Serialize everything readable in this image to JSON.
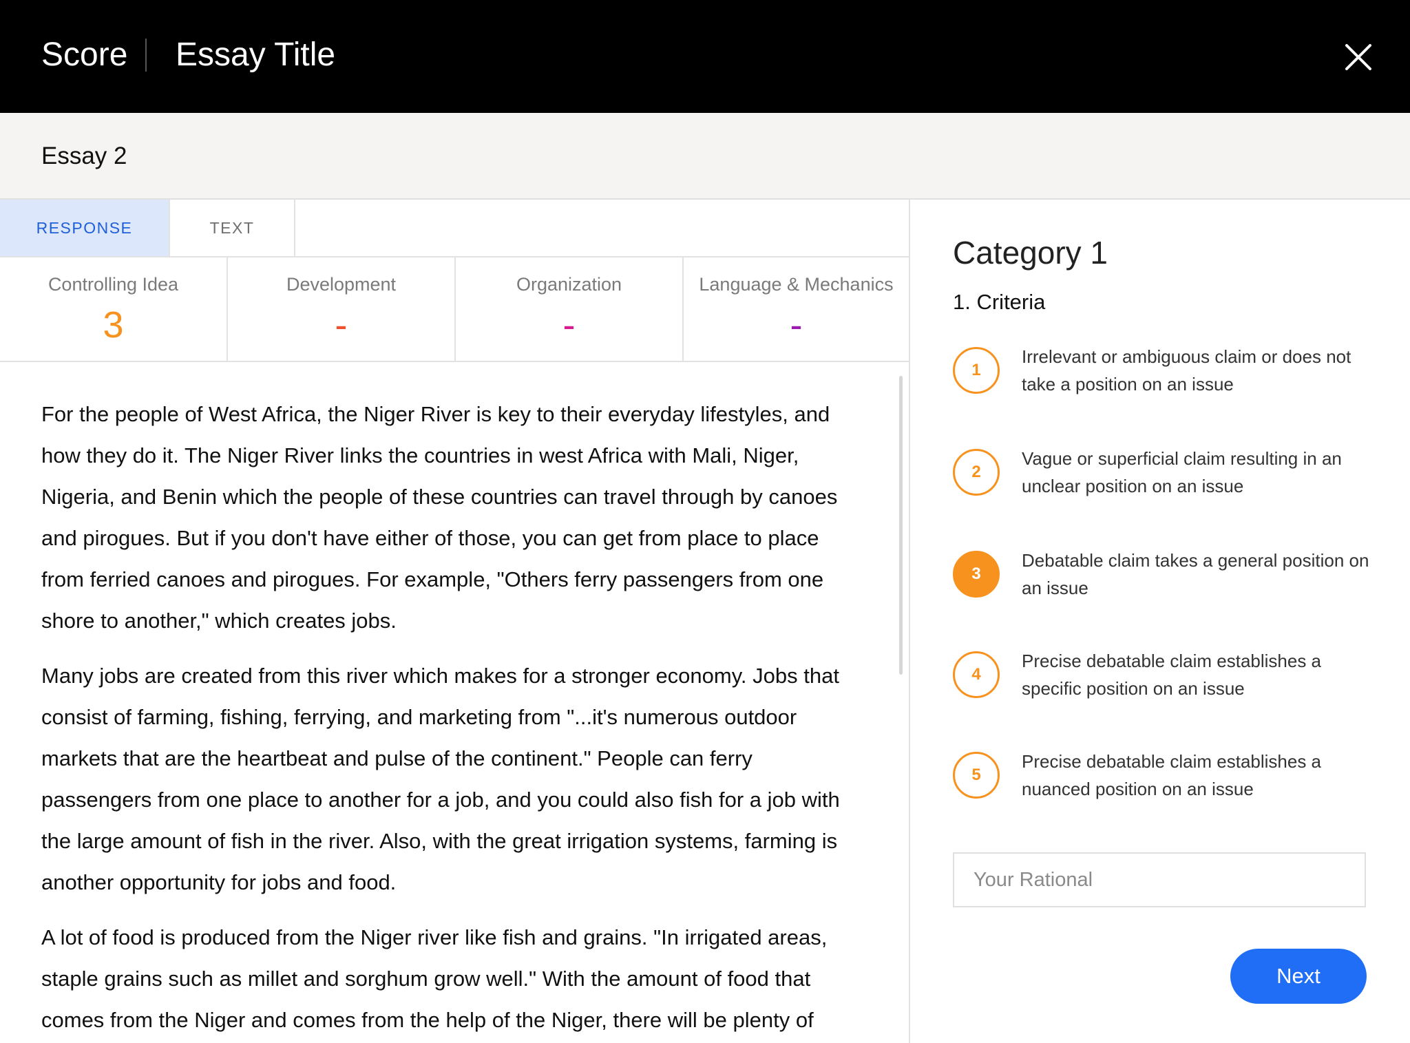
{
  "header": {
    "app_title": "Score",
    "essay_title": "Essay Title",
    "close_icon": "close-icon",
    "background": "#000000"
  },
  "subheader": {
    "essay_name": "Essay 2"
  },
  "tabs": [
    {
      "label": "RESPONSE",
      "active": true
    },
    {
      "label": "TEXT",
      "active": false
    }
  ],
  "scores": [
    {
      "label": "Controlling Idea",
      "value": "3",
      "color": "#f7921e"
    },
    {
      "label": "Development",
      "value": "-",
      "color": "#f0502e"
    },
    {
      "label": "Organization",
      "value": "-",
      "color": "#d81b8f"
    },
    {
      "label": "Language & Mechanics",
      "value": "-",
      "color": "#9c1bb0"
    }
  ],
  "essay": {
    "paragraphs": [
      "For the people of West Africa, the Niger River is key to their everyday lifestyles, and how they do it. The Niger River links the countries in west Africa with Mali, Niger, Nigeria, and Benin which the people of these countries can travel through by canoes and pirogues. But if you don't have either of those, you can get from place to place from ferried canoes and pirogues. For example, \"Others ferry passengers from one shore to another,\" which creates jobs.",
      "Many jobs are created from this river which makes for a stronger economy. Jobs that consist of farming, fishing, ferrying, and marketing from \"...it's numerous outdoor markets that are the heartbeat and pulse of the continent.\" People can ferry passengers from one place to another for a job, and you could also fish for a job with the large amount of fish in the river. Also, with the great irrigation systems, farming is another opportunity for jobs and food.",
      "A lot of food is produced from the Niger river like fish and grains. \"In irrigated areas, staple grains such as millet and sorghum grow well.\" With the amount of food that comes from the Niger and comes from the help of the Niger, there will be plenty of"
    ]
  },
  "rubric": {
    "category_title": "Category 1",
    "criteria_title": "1. Criteria",
    "selected": 3,
    "accent_color": "#f7921e",
    "criteria": [
      {
        "number": "1",
        "text": "Irrelevant or ambiguous claim or does not take a position on an issue"
      },
      {
        "number": "2",
        "text": "Vague or superficial claim resulting in an unclear position on an issue"
      },
      {
        "number": "3",
        "text": "Debatable claim takes a general position on an issue"
      },
      {
        "number": "4",
        "text": "Precise debatable claim establishes a specific position on an issue"
      },
      {
        "number": "5",
        "text": "Precise debatable claim establishes a nuanced position on an issue"
      }
    ],
    "rationale_placeholder": "Your Rational",
    "next_label": "Next",
    "next_color": "#1f6ef5"
  }
}
